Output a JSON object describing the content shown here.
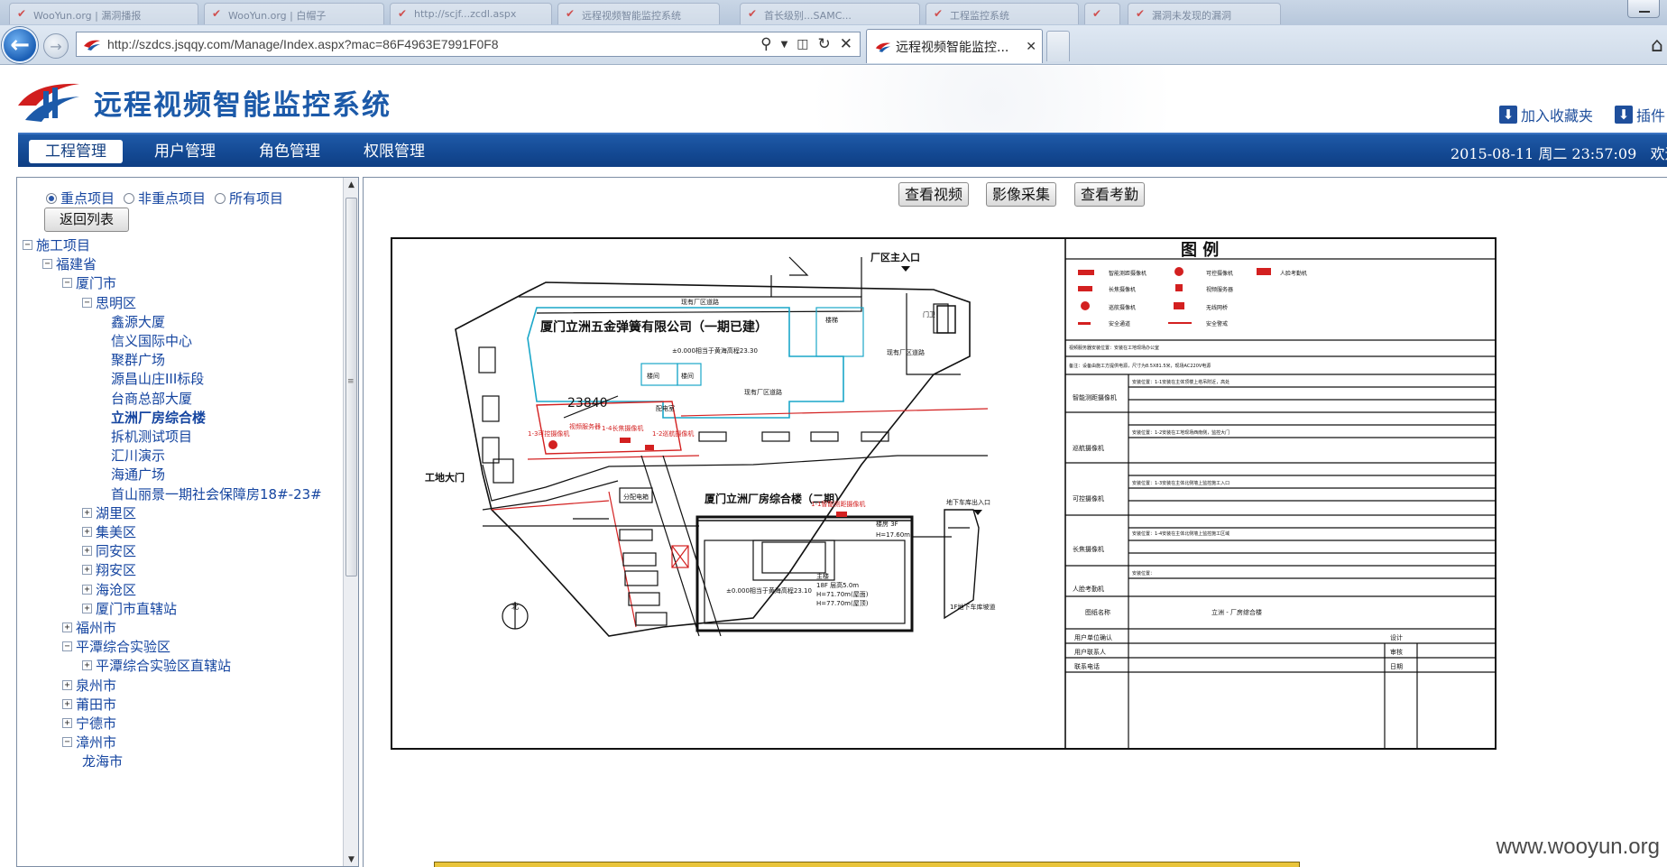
{
  "browser": {
    "url": "http://szdcs.jsqqy.com/Manage/Index.aspx?mac=86F4963E7991F0F8",
    "active_tab_title": "远程视频智能监控...",
    "background_tabs": [
      "WooYun.org | 漏洞播报",
      "WooYun.org | 白帽子",
      "http://scjf...zcdl.aspx",
      "远程视频智能监控系统",
      "首长级别...SAMC...",
      "工程监控系统",
      "",
      "漏洞未发现的漏洞"
    ]
  },
  "header": {
    "title": "远程视频智能监控系统",
    "links": [
      "加入收藏夹",
      "插件"
    ]
  },
  "menu": {
    "items": [
      "工程管理",
      "用户管理",
      "角色管理",
      "权限管理"
    ],
    "active": "工程管理",
    "datetime": "2015-08-11 周二 23:57:09",
    "welcome": "欢迎你:"
  },
  "filter": {
    "options": [
      "重点项目",
      "非重点项目",
      "所有项目"
    ],
    "selected": "重点项目",
    "back_button": "返回列表"
  },
  "tree": [
    {
      "label": "施工项目",
      "level": 0,
      "toggle": "minus"
    },
    {
      "label": "福建省",
      "level": 1,
      "toggle": "minus"
    },
    {
      "label": "厦门市",
      "level": 2,
      "toggle": "minus"
    },
    {
      "label": "思明区",
      "level": 3,
      "toggle": "minus"
    },
    {
      "label": "鑫源大厦",
      "level": 4,
      "toggle": ""
    },
    {
      "label": "信义国际中心",
      "level": 4,
      "toggle": ""
    },
    {
      "label": "聚群广场",
      "level": 4,
      "toggle": ""
    },
    {
      "label": "源昌山庄III标段",
      "level": 4,
      "toggle": ""
    },
    {
      "label": "台商总部大厦",
      "level": 4,
      "toggle": ""
    },
    {
      "label": "立洲厂房综合楼",
      "level": 4,
      "toggle": "",
      "selected": true
    },
    {
      "label": "拆机测试项目",
      "level": 4,
      "toggle": ""
    },
    {
      "label": "汇川演示",
      "level": 4,
      "toggle": ""
    },
    {
      "label": "海通广场",
      "level": 4,
      "toggle": ""
    },
    {
      "label": "首山丽景一期社会保障房18#-23#",
      "level": 4,
      "toggle": ""
    },
    {
      "label": "湖里区",
      "level": 3,
      "toggle": "plus"
    },
    {
      "label": "集美区",
      "level": 3,
      "toggle": "plus"
    },
    {
      "label": "同安区",
      "level": 3,
      "toggle": "plus"
    },
    {
      "label": "翔安区",
      "level": 3,
      "toggle": "plus"
    },
    {
      "label": "海沧区",
      "level": 3,
      "toggle": "plus"
    },
    {
      "label": "厦门市直辖站",
      "level": 3,
      "toggle": "plus"
    },
    {
      "label": "福州市",
      "level": 2,
      "toggle": "plus"
    },
    {
      "label": "平潭综合实验区",
      "level": 2,
      "toggle": "minus"
    },
    {
      "label": "平潭综合实验区直辖站",
      "level": 3,
      "toggle": "plus"
    },
    {
      "label": "泉州市",
      "level": 2,
      "toggle": "plus"
    },
    {
      "label": "莆田市",
      "level": 2,
      "toggle": "plus"
    },
    {
      "label": "宁德市",
      "level": 2,
      "toggle": "plus"
    },
    {
      "label": "漳州市",
      "level": 2,
      "toggle": "minus"
    },
    {
      "label": "龙海市",
      "level": 3,
      "toggle": ""
    }
  ],
  "content": {
    "buttons": [
      "查看视频",
      "影像采集",
      "查看考勤"
    ],
    "plan": {
      "main_entrance": "厂区主入口",
      "company_name": "厦门立洲五金弹簧有限公司（一期已建）",
      "building2": "厦门立洲厂房综合楼（二期）",
      "site_gate": "工地大门",
      "dim_text": "23840",
      "elevation_note": "±0.000相当于黄海高程23.30",
      "elevation_note2": "±0.000相当于黄海高程23.10",
      "stairs": [
        "楼梯",
        "楼间",
        "楼间"
      ],
      "rooms": [
        "配电室",
        "分配电箱"
      ],
      "roads": [
        "现有厂区道路",
        "现有厂区道路",
        "现有厂区道路"
      ],
      "cam_labels": [
        "1-3可控摄像机",
        "1-4长焦摄像机",
        "1-2巡航摄像机",
        "1-1智能测距摄像机",
        "视频服务器"
      ],
      "underground_entry": "地下车库出入口",
      "building_info": [
        "主楼",
        "18F 层高5.0m",
        "H=71.70m(屋面)",
        "H=77.70m(屋顶)"
      ],
      "side_info": [
        "楼房 3F",
        "H=17.60m"
      ],
      "ramp": "1F地下车库坡道",
      "gate_label": "门卫",
      "north": "北",
      "legend_title": "图 例",
      "legend_items": [
        "智能测距摄像机",
        "可控摄像机",
        "人脸考勤机",
        "长焦摄像机",
        "视频服务器",
        "巡航摄像机",
        "无线网桥",
        "安全通道",
        "安全警戒"
      ],
      "table_rows": [
        {
          "name": "智能测距摄像机",
          "note": "安装位置：1-1安装在主体顶楼上塔吊附近，高处"
        },
        {
          "name": "巡航摄像机",
          "note": "安装位置：1-2安装在工地现场西南侧，监控大门"
        },
        {
          "name": "可控摄像机",
          "note": "安装位置：1-3安装在主体北侧墙上监控施工入口"
        },
        {
          "name": "长焦摄像机",
          "note": "安装位置：1-4安装在主体北侧墙上监控施工区域"
        },
        {
          "name": "人脸考勤机",
          "note": "安装位置："
        }
      ],
      "notes": [
        "视频服务器安装位置：安装在工地现场办公室",
        "备注：设备由施工方提供电源，尺寸为8.5X81.5米，现场AC220V电源"
      ],
      "footer": {
        "drawing_name_label": "图纸名称",
        "drawing_name": "立洲 - 厂房综合楼",
        "rows": [
          [
            "用户单位确认",
            "设计"
          ],
          [
            "用户联系人",
            "审核"
          ],
          [
            "联系电话",
            "日期"
          ]
        ]
      }
    }
  },
  "watermark": "www.wooyun.org"
}
